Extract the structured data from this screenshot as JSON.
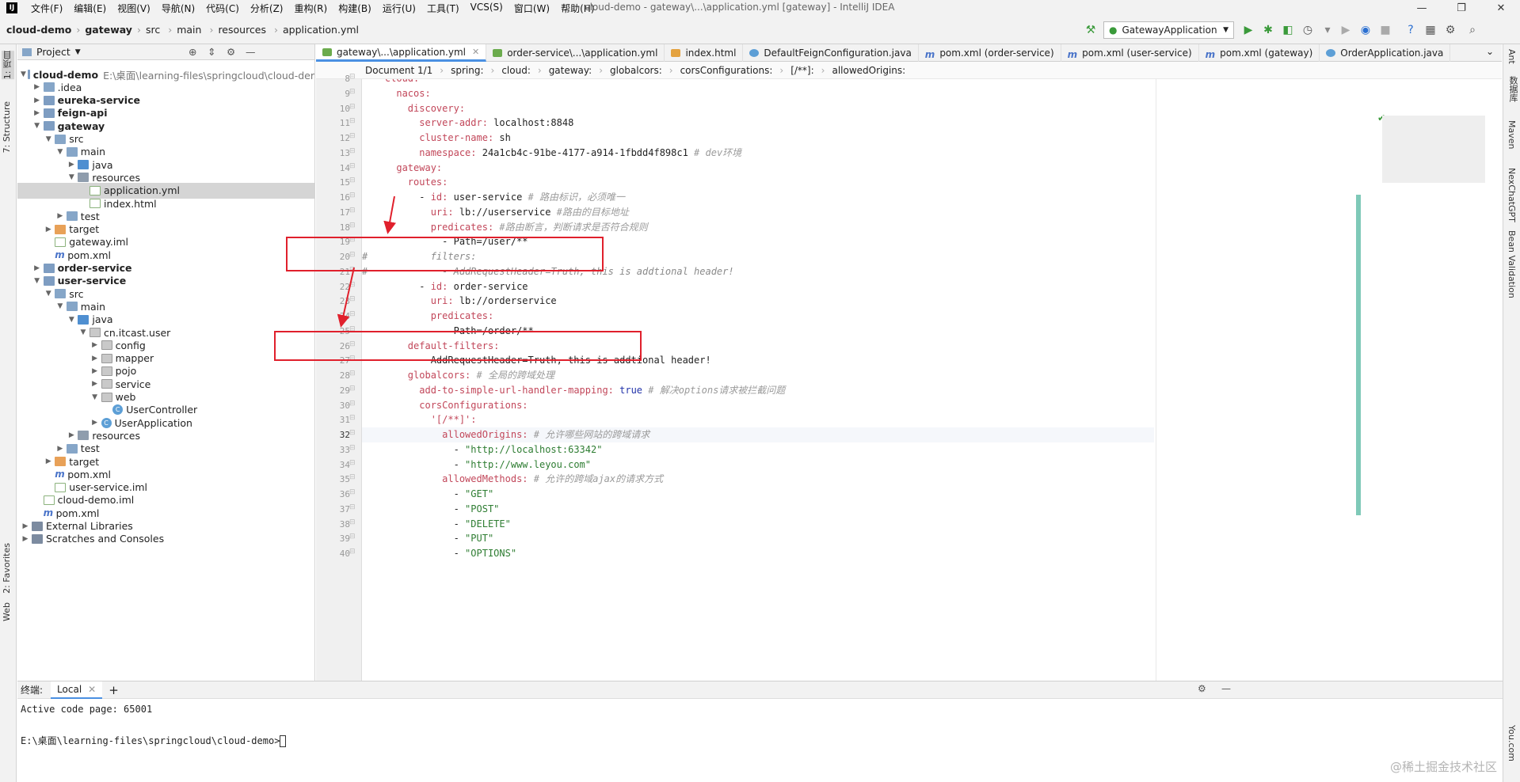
{
  "menu": {
    "items": [
      "文件(F)",
      "编辑(E)",
      "视图(V)",
      "导航(N)",
      "代码(C)",
      "分析(Z)",
      "重构(R)",
      "构建(B)",
      "运行(U)",
      "工具(T)",
      "VCS(S)",
      "窗口(W)",
      "帮助(H)"
    ],
    "window_title": "cloud-demo - gateway\\...\\application.yml [gateway] - IntelliJ IDEA"
  },
  "nav": {
    "crumbs": [
      "cloud-demo",
      "gateway",
      "src",
      "main",
      "resources",
      "application.yml"
    ],
    "run_config": "GatewayApplication"
  },
  "tool_windows": {
    "left": [
      "1: 项目",
      "7: Structure",
      "2: Favorites",
      "Web"
    ],
    "right": [
      "Ant",
      "数据库",
      "Maven",
      "NexChatGPT",
      "Bean Validation",
      "You.com"
    ]
  },
  "project": {
    "header": "Project",
    "tree": [
      {
        "label": "cloud-demo",
        "path": "E:\\桌面\\learning-files\\springcloud\\cloud-der",
        "indent": 0,
        "arrow": "▼",
        "icon": "folder mod",
        "bold": true
      },
      {
        "label": ".idea",
        "indent": 1,
        "arrow": "▶",
        "icon": "folder"
      },
      {
        "label": "eureka-service",
        "indent": 1,
        "arrow": "▶",
        "icon": "folder mod",
        "bold": true
      },
      {
        "label": "feign-api",
        "indent": 1,
        "arrow": "▶",
        "icon": "folder mod",
        "bold": true
      },
      {
        "label": "gateway",
        "indent": 1,
        "arrow": "▼",
        "icon": "folder mod",
        "bold": true
      },
      {
        "label": "src",
        "indent": 2,
        "arrow": "▼",
        "icon": "folder"
      },
      {
        "label": "main",
        "indent": 3,
        "arrow": "▼",
        "icon": "folder"
      },
      {
        "label": "java",
        "indent": 4,
        "arrow": "▶",
        "icon": "folder src"
      },
      {
        "label": "resources",
        "indent": 4,
        "arrow": "▼",
        "icon": "folder res"
      },
      {
        "label": "application.yml",
        "indent": 5,
        "arrow": "",
        "icon": "file",
        "selected": true
      },
      {
        "label": "index.html",
        "indent": 5,
        "arrow": "",
        "icon": "file"
      },
      {
        "label": "test",
        "indent": 3,
        "arrow": "▶",
        "icon": "folder"
      },
      {
        "label": "target",
        "indent": 2,
        "arrow": "▶",
        "icon": "folder tgt"
      },
      {
        "label": "gateway.iml",
        "indent": 2,
        "arrow": "",
        "icon": "file"
      },
      {
        "label": "pom.xml",
        "indent": 2,
        "arrow": "",
        "icon": "m"
      },
      {
        "label": "order-service",
        "indent": 1,
        "arrow": "▶",
        "icon": "folder mod",
        "bold": true
      },
      {
        "label": "user-service",
        "indent": 1,
        "arrow": "▼",
        "icon": "folder mod",
        "bold": true
      },
      {
        "label": "src",
        "indent": 2,
        "arrow": "▼",
        "icon": "folder"
      },
      {
        "label": "main",
        "indent": 3,
        "arrow": "▼",
        "icon": "folder"
      },
      {
        "label": "java",
        "indent": 4,
        "arrow": "▼",
        "icon": "folder src"
      },
      {
        "label": "cn.itcast.user",
        "indent": 5,
        "arrow": "▼",
        "icon": "folder pkg"
      },
      {
        "label": "config",
        "indent": 6,
        "arrow": "▶",
        "icon": "folder pkg"
      },
      {
        "label": "mapper",
        "indent": 6,
        "arrow": "▶",
        "icon": "folder pkg"
      },
      {
        "label": "pojo",
        "indent": 6,
        "arrow": "▶",
        "icon": "folder pkg"
      },
      {
        "label": "service",
        "indent": 6,
        "arrow": "▶",
        "icon": "folder pkg"
      },
      {
        "label": "web",
        "indent": 6,
        "arrow": "▼",
        "icon": "folder pkg"
      },
      {
        "label": "UserController",
        "indent": 7,
        "arrow": "",
        "icon": "c"
      },
      {
        "label": "UserApplication",
        "indent": 6,
        "arrow": "▶",
        "icon": "c"
      },
      {
        "label": "resources",
        "indent": 4,
        "arrow": "▶",
        "icon": "folder res"
      },
      {
        "label": "test",
        "indent": 3,
        "arrow": "▶",
        "icon": "folder"
      },
      {
        "label": "target",
        "indent": 2,
        "arrow": "▶",
        "icon": "folder tgt"
      },
      {
        "label": "pom.xml",
        "indent": 2,
        "arrow": "",
        "icon": "m"
      },
      {
        "label": "user-service.iml",
        "indent": 2,
        "arrow": "",
        "icon": "file"
      },
      {
        "label": "cloud-demo.iml",
        "indent": 1,
        "arrow": "",
        "icon": "file"
      },
      {
        "label": "pom.xml",
        "indent": 1,
        "arrow": "",
        "icon": "m"
      },
      {
        "label": "External Libraries",
        "indent": 0,
        "arrow": "▶",
        "icon": "lib"
      },
      {
        "label": "Scratches and Consoles",
        "indent": 0,
        "arrow": "▶",
        "icon": "lib"
      }
    ]
  },
  "editor": {
    "tabs": [
      {
        "label": "gateway\\...\\application.yml",
        "icon": "y",
        "active": true
      },
      {
        "label": "order-service\\...\\application.yml",
        "icon": "y"
      },
      {
        "label": "index.html",
        "icon": "h"
      },
      {
        "label": "DefaultFeignConfiguration.java",
        "icon": "c"
      },
      {
        "label": "pom.xml (order-service)",
        "icon": "m"
      },
      {
        "label": "pom.xml (user-service)",
        "icon": "m"
      },
      {
        "label": "pom.xml (gateway)",
        "icon": "m"
      },
      {
        "label": "OrderApplication.java",
        "icon": "c"
      }
    ],
    "breadcrumb": [
      "Document 1/1",
      "spring:",
      "cloud:",
      "gateway:",
      "globalcors:",
      "corsConfigurations:",
      "[/**]:",
      "allowedOrigins:"
    ],
    "current_line": 32,
    "lines": [
      {
        "n": 8,
        "t": [
          [
            "    ",
            ""
          ],
          [
            "cloud:",
            "k"
          ]
        ]
      },
      {
        "n": 9,
        "t": [
          [
            "      ",
            ""
          ],
          [
            "nacos:",
            "k"
          ]
        ]
      },
      {
        "n": 10,
        "t": [
          [
            "        ",
            ""
          ],
          [
            "discovery:",
            "k"
          ]
        ]
      },
      {
        "n": 11,
        "t": [
          [
            "          ",
            ""
          ],
          [
            "server-addr:",
            "k"
          ],
          [
            " localhost:8848",
            "v"
          ]
        ]
      },
      {
        "n": 12,
        "t": [
          [
            "          ",
            ""
          ],
          [
            "cluster-name:",
            "k"
          ],
          [
            " sh",
            "v"
          ]
        ]
      },
      {
        "n": 13,
        "t": [
          [
            "          ",
            ""
          ],
          [
            "namespace:",
            "k"
          ],
          [
            " 24a1cb4c-91be-4177-a914-1fbdd4f898c1 ",
            "v"
          ],
          [
            "# dev环境",
            "zh"
          ]
        ]
      },
      {
        "n": 14,
        "t": [
          [
            "      ",
            ""
          ],
          [
            "gateway:",
            "k"
          ]
        ]
      },
      {
        "n": 15,
        "t": [
          [
            "        ",
            ""
          ],
          [
            "routes:",
            "k"
          ]
        ]
      },
      {
        "n": 16,
        "t": [
          [
            "          - ",
            ""
          ],
          [
            "id:",
            "k"
          ],
          [
            " user-service ",
            "v"
          ],
          [
            "# 路由标识，必须唯一",
            "zh"
          ]
        ]
      },
      {
        "n": 17,
        "t": [
          [
            "            ",
            ""
          ],
          [
            "uri:",
            "k"
          ],
          [
            " lb://userservice ",
            "v"
          ],
          [
            "#路由的目标地址",
            "zh"
          ]
        ]
      },
      {
        "n": 18,
        "t": [
          [
            "            ",
            ""
          ],
          [
            "predicates:",
            "k"
          ],
          [
            " ",
            "v"
          ],
          [
            "#路由断言，判断请求是否符合规则",
            "zh"
          ]
        ]
      },
      {
        "n": 19,
        "t": [
          [
            "              - Path=/user/**",
            "v"
          ]
        ]
      },
      {
        "n": 20,
        "t": [
          [
            "#",
            "cm"
          ],
          [
            "           filters:",
            "cm"
          ]
        ]
      },
      {
        "n": 21,
        "t": [
          [
            "#",
            "cm"
          ],
          [
            "             - AddRequestHeader=Truth, this is addtional header!",
            "cm"
          ]
        ]
      },
      {
        "n": 22,
        "t": [
          [
            "          - ",
            ""
          ],
          [
            "id:",
            "k"
          ],
          [
            " order-service",
            "v"
          ]
        ]
      },
      {
        "n": 23,
        "t": [
          [
            "            ",
            ""
          ],
          [
            "uri:",
            "k"
          ],
          [
            " lb://orderservice",
            "v"
          ]
        ]
      },
      {
        "n": 24,
        "t": [
          [
            "            ",
            ""
          ],
          [
            "predicates:",
            "k"
          ]
        ]
      },
      {
        "n": 25,
        "t": [
          [
            "              - Path=/order/**",
            "v"
          ]
        ]
      },
      {
        "n": 26,
        "t": [
          [
            "        ",
            ""
          ],
          [
            "default-filters:",
            "k"
          ]
        ]
      },
      {
        "n": 27,
        "t": [
          [
            "          - AddRequestHeader=Truth, this is addtional header!",
            "v"
          ]
        ]
      },
      {
        "n": 28,
        "t": [
          [
            "        ",
            ""
          ],
          [
            "globalcors:",
            "k"
          ],
          [
            " ",
            "v"
          ],
          [
            "# 全局的跨域处理",
            "zh"
          ]
        ]
      },
      {
        "n": 29,
        "t": [
          [
            "          ",
            ""
          ],
          [
            "add-to-simple-url-handler-mapping:",
            "k"
          ],
          [
            " ",
            "v"
          ],
          [
            "true",
            "bl"
          ],
          [
            " ",
            "v"
          ],
          [
            "# 解决options请求被拦截问题",
            "zh"
          ]
        ]
      },
      {
        "n": 30,
        "t": [
          [
            "          ",
            ""
          ],
          [
            "corsConfigurations:",
            "k"
          ]
        ]
      },
      {
        "n": 31,
        "t": [
          [
            "            ",
            ""
          ],
          [
            "'[/**]':",
            "k"
          ]
        ]
      },
      {
        "n": 32,
        "t": [
          [
            "              ",
            ""
          ],
          [
            "allowedOrigins:",
            "k"
          ],
          [
            " ",
            "v"
          ],
          [
            "# 允许哪些网站的跨域请求",
            "zh"
          ]
        ]
      },
      {
        "n": 33,
        "t": [
          [
            "                - ",
            ""
          ],
          [
            "\"http://localhost:63342\"",
            "s"
          ]
        ]
      },
      {
        "n": 34,
        "t": [
          [
            "                - ",
            ""
          ],
          [
            "\"http://www.leyou.com\"",
            "s"
          ]
        ]
      },
      {
        "n": 35,
        "t": [
          [
            "              ",
            ""
          ],
          [
            "allowedMethods:",
            "k"
          ],
          [
            " ",
            "v"
          ],
          [
            "# 允许的跨域ajax的请求方式",
            "zh"
          ]
        ]
      },
      {
        "n": 36,
        "t": [
          [
            "                - ",
            ""
          ],
          [
            "\"GET\"",
            "s"
          ]
        ]
      },
      {
        "n": 37,
        "t": [
          [
            "                - ",
            ""
          ],
          [
            "\"POST\"",
            "s"
          ]
        ]
      },
      {
        "n": 38,
        "t": [
          [
            "                - ",
            ""
          ],
          [
            "\"DELETE\"",
            "s"
          ]
        ]
      },
      {
        "n": 39,
        "t": [
          [
            "                - ",
            ""
          ],
          [
            "\"PUT\"",
            "s"
          ]
        ]
      },
      {
        "n": 40,
        "t": [
          [
            "                - ",
            ""
          ],
          [
            "\"OPTIONS\"",
            "s"
          ]
        ]
      }
    ]
  },
  "terminal": {
    "title": "终端:",
    "tab": "Local",
    "lines": [
      "Active code page: 65001",
      "",
      "E:\\桌面\\learning-files\\springcloud\\cloud-demo>"
    ]
  },
  "watermark": "@稀土掘金技术社区"
}
